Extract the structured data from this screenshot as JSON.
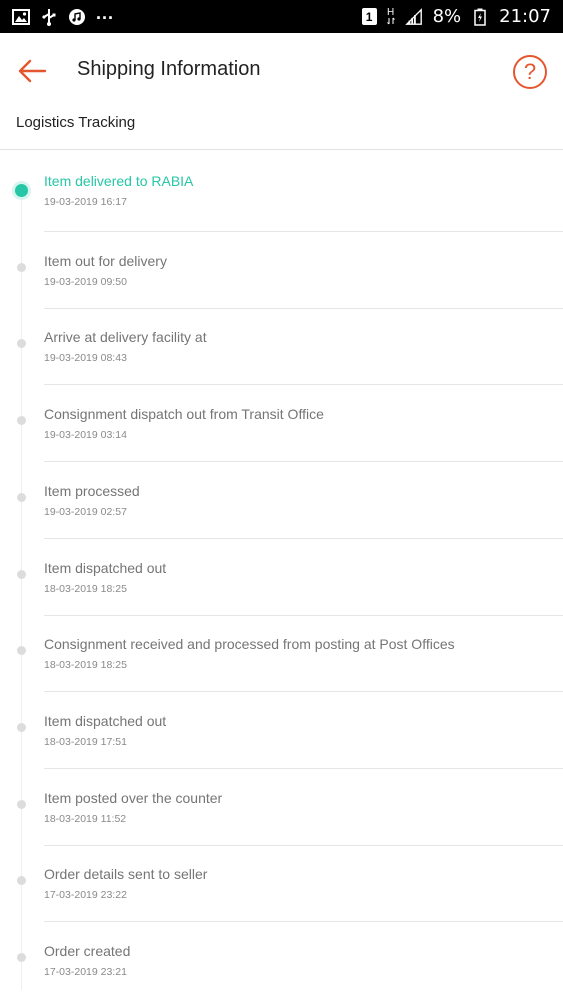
{
  "status_bar": {
    "sim_slot": "1",
    "network_type": "H",
    "battery_percent": "8%",
    "time": "21:07",
    "more_indicator": "...",
    "icons": [
      "image-icon",
      "usb-debug-icon",
      "music-icon",
      "sim-icon",
      "signal-icon",
      "battery-icon"
    ]
  },
  "header": {
    "title": "Shipping Information",
    "back_icon": "arrow-left-icon",
    "help_label": "?",
    "accent_color": "#e4572e"
  },
  "section": {
    "title": "Logistics Tracking"
  },
  "tracking": {
    "active_color": "#26c6a6",
    "events": [
      {
        "status": "Item delivered to RABIA",
        "time": "19-03-2019 16:17",
        "active": true
      },
      {
        "status": "Item out for delivery",
        "time": "19-03-2019 09:50",
        "active": false
      },
      {
        "status": "Arrive at delivery facility at",
        "time": "19-03-2019 08:43",
        "active": false
      },
      {
        "status": "Consignment dispatch out from Transit Office",
        "time": "19-03-2019 03:14",
        "active": false
      },
      {
        "status": "Item processed",
        "time": "19-03-2019 02:57",
        "active": false
      },
      {
        "status": "Item dispatched out",
        "time": "18-03-2019 18:25",
        "active": false
      },
      {
        "status": "Consignment received and processed from posting at Post Offices",
        "time": "18-03-2019 18:25",
        "active": false
      },
      {
        "status": "Item dispatched out",
        "time": "18-03-2019 17:51",
        "active": false
      },
      {
        "status": "Item posted over the counter",
        "time": "18-03-2019 11:52",
        "active": false
      },
      {
        "status": "Order details sent to seller",
        "time": "17-03-2019 23:22",
        "active": false
      },
      {
        "status": "Order created",
        "time": "17-03-2019 23:21",
        "active": false
      }
    ]
  }
}
